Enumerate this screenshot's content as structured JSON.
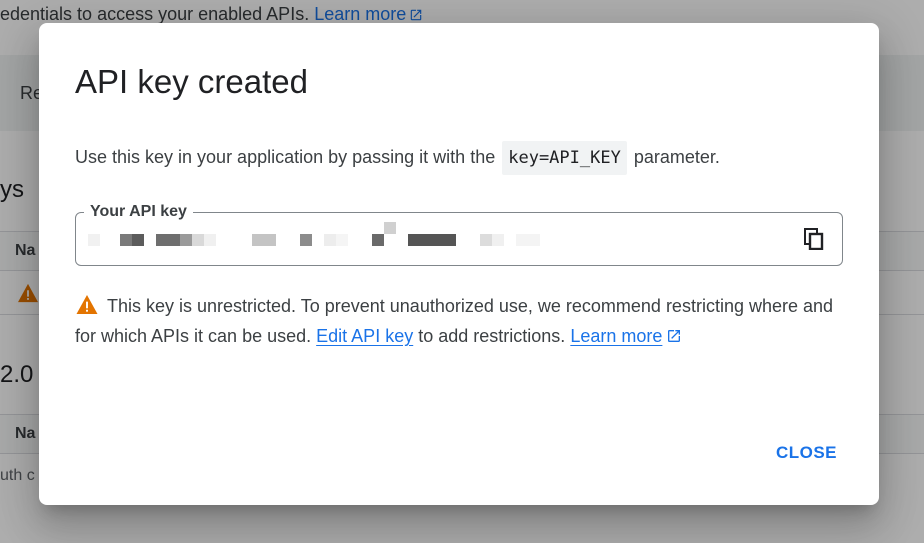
{
  "background": {
    "intro_text": "edentials to access your enabled APIs.",
    "intro_link": "Learn more",
    "band_text": "Re",
    "heading1": "ys",
    "table1_header": "Na",
    "heading2": "2.0",
    "table2_header": "Na",
    "empty_text": "uth c"
  },
  "dialog": {
    "title": "API key created",
    "intro_before": "Use this key in your application by passing it with the",
    "intro_code": "key=API_KEY",
    "intro_after": "parameter.",
    "field_label": "Your API key",
    "warning_text": "This key is unrestricted. To prevent unauthorized use, we recommend restricting where and for which APIs it can be used.",
    "edit_link": "Edit API key",
    "after_edit": "to add restrictions.",
    "learn_more": "Learn more",
    "close_label": "CLOSE"
  },
  "icons": {
    "copy": "copy-icon",
    "warning": "warning-icon",
    "external_link": "external-link-icon"
  },
  "colors": {
    "accent": "#1a73e8",
    "warning": "#e37400",
    "scrim": "rgba(0,0,0,0.32)"
  }
}
